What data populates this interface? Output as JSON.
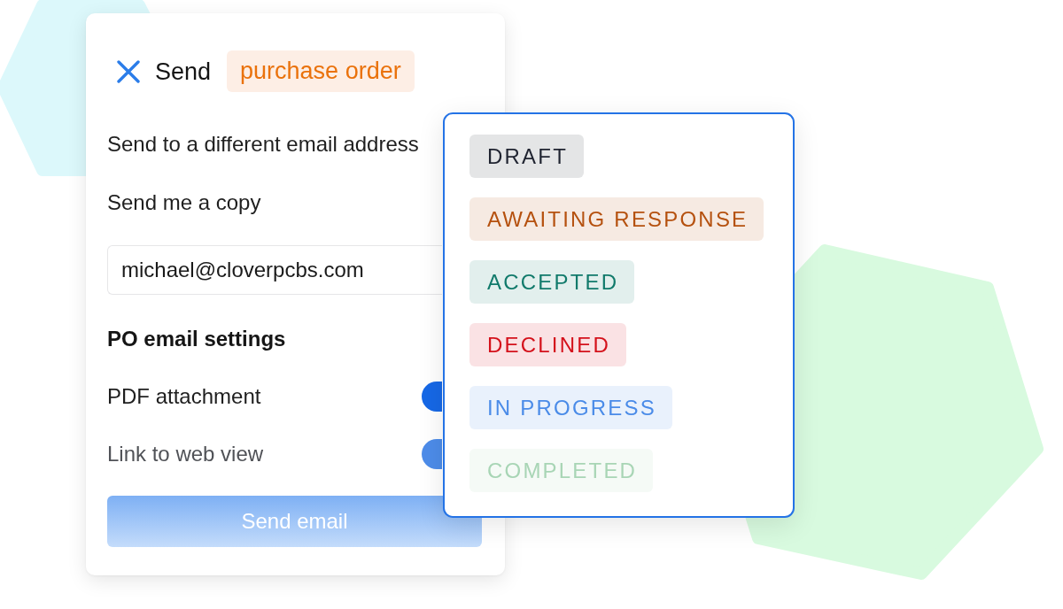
{
  "dialog": {
    "title": "Send",
    "document_badge": "purchase order",
    "options": [
      {
        "label": "Send to a different email address"
      },
      {
        "label": "Send me a copy"
      }
    ],
    "email_field": {
      "value": "michael@cloverpcbs.com"
    },
    "settings_heading": "PO email settings",
    "settings": [
      {
        "label": "PDF attachment",
        "on": true
      },
      {
        "label": "Link to web view",
        "on": true
      }
    ],
    "send_button": {
      "label": "Send email",
      "disabled": true
    }
  },
  "status_menu": {
    "statuses": [
      {
        "label": "DRAFT",
        "color": "#1f2330"
      },
      {
        "label": "AWAITING RESPONSE",
        "color": "#b5510f"
      },
      {
        "label": "ACCEPTED",
        "color": "#117a6b"
      },
      {
        "label": "DECLINED",
        "color": "#d4111b"
      },
      {
        "label": "IN PROGRESS",
        "color": "#4a8be8"
      },
      {
        "label": "COMPLETED",
        "color": "#a8d5b5"
      }
    ]
  }
}
